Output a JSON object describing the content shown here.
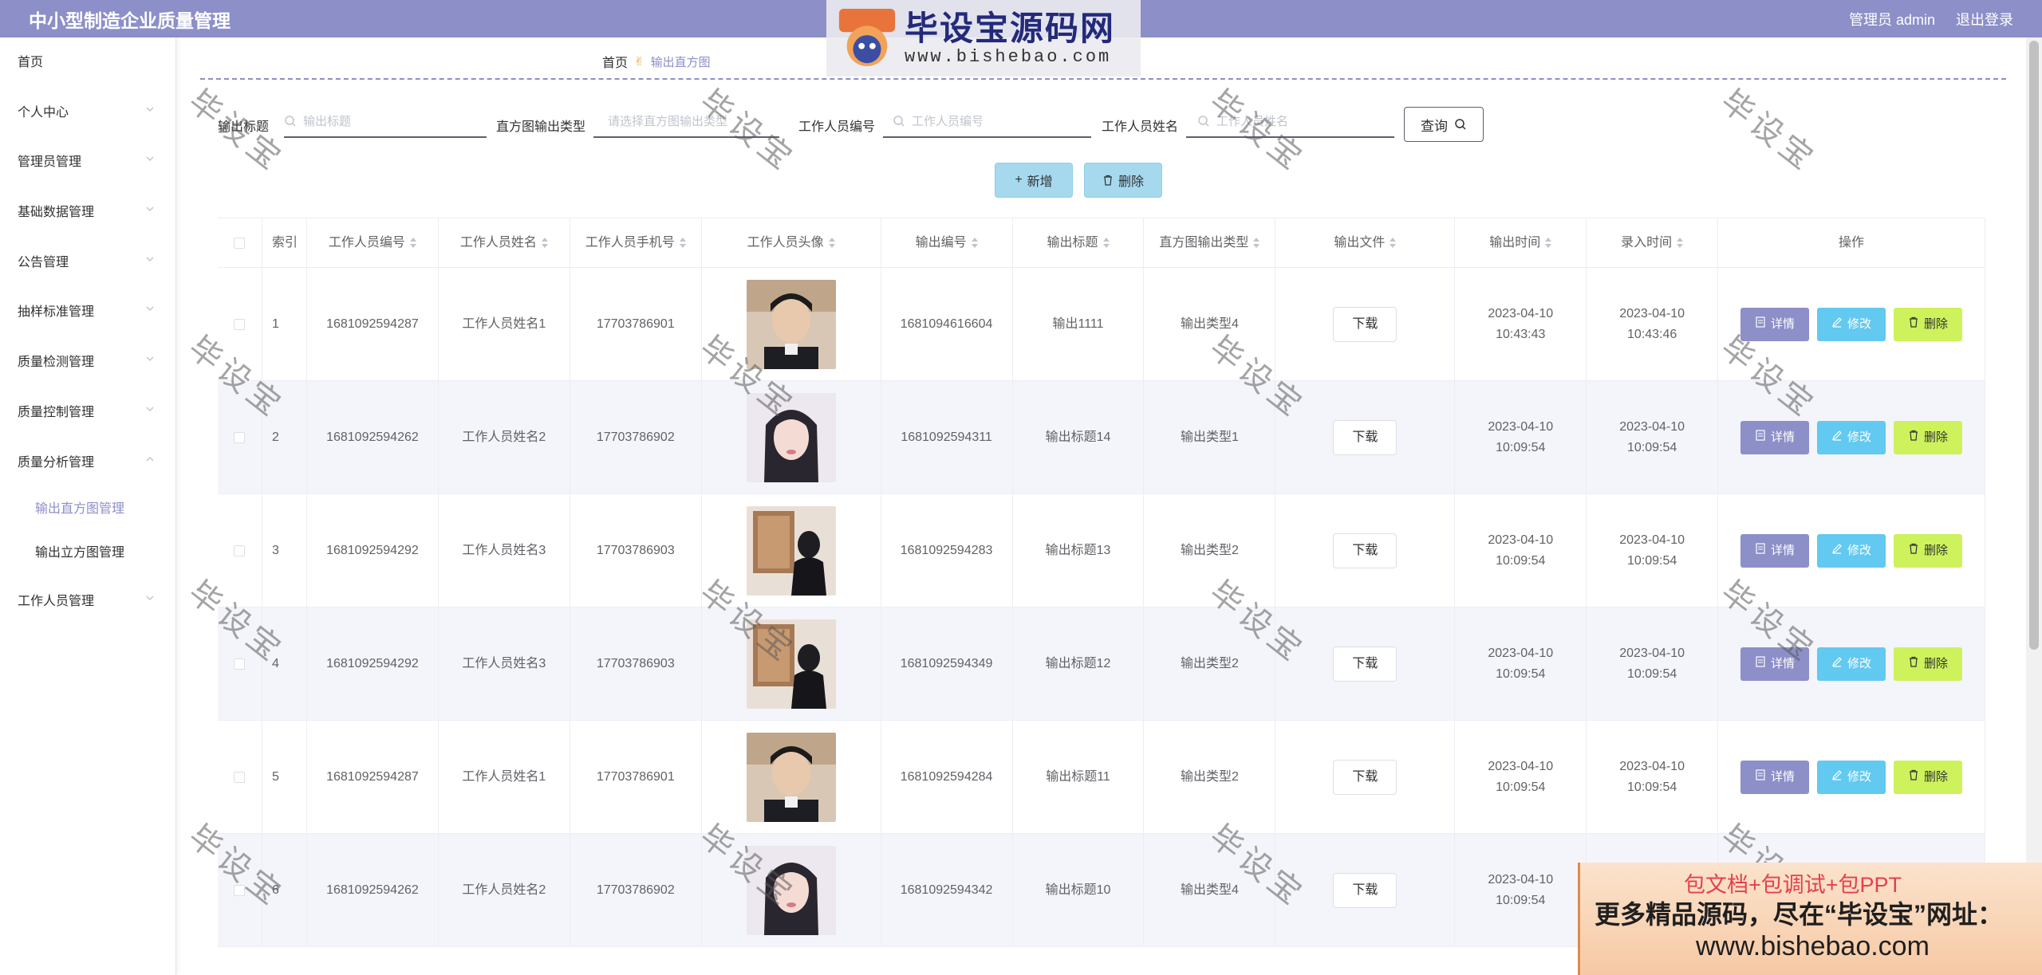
{
  "header": {
    "title": "中小型制造企业质量管理",
    "user": "管理员 admin",
    "logout": "退出登录"
  },
  "sidebar": {
    "items": [
      {
        "label": "首页"
      },
      {
        "label": "个人中心"
      },
      {
        "label": "管理员管理"
      },
      {
        "label": "基础数据管理"
      },
      {
        "label": "公告管理"
      },
      {
        "label": "抽样标准管理"
      },
      {
        "label": "质量检测管理"
      },
      {
        "label": "质量控制管理"
      },
      {
        "label": "质量分析管理"
      },
      {
        "label": "输出直方图管理"
      },
      {
        "label": "输出立方图管理"
      },
      {
        "label": "工作人员管理"
      }
    ]
  },
  "breadcrumb": {
    "home": "首页",
    "current": "输出直方图"
  },
  "search": {
    "title_label": "输出标题",
    "title_placeholder": "输出标题",
    "type_label": "直方图输出类型",
    "type_placeholder": "请选择直方图输出类型",
    "staff_no_label": "工作人员编号",
    "staff_no_placeholder": "工作人员编号",
    "staff_name_label": "工作人员姓名",
    "staff_name_placeholder": "工作人员姓名",
    "query_button": "查询"
  },
  "actions": {
    "add": "新增",
    "delete": "删除"
  },
  "table": {
    "columns": [
      "",
      "索引",
      "工作人员编号",
      "工作人员姓名",
      "工作人员手机号",
      "工作人员头像",
      "输出编号",
      "输出标题",
      "直方图输出类型",
      "输出文件",
      "输出时间",
      "录入时间",
      "操作"
    ],
    "download_label": "下载",
    "op_detail": "详情",
    "op_edit": "修改",
    "op_delete": "删除",
    "rows": [
      {
        "index": "1",
        "staff_no": "1681092594287",
        "staff_name": "工作人员姓名1",
        "phone": "17703786901",
        "avatar": "man-a",
        "out_no": "1681094616604",
        "out_title": "输出1111",
        "out_type": "输出类型4",
        "out_time": "2023-04-10 10:43:43",
        "entry_time": "2023-04-10 10:43:46"
      },
      {
        "index": "2",
        "staff_no": "1681092594262",
        "staff_name": "工作人员姓名2",
        "phone": "17703786902",
        "avatar": "woman",
        "out_no": "1681092594311",
        "out_title": "输出标题14",
        "out_type": "输出类型1",
        "out_time": "2023-04-10 10:09:54",
        "entry_time": "2023-04-10 10:09:54"
      },
      {
        "index": "3",
        "staff_no": "1681092594292",
        "staff_name": "工作人员姓名3",
        "phone": "17703786903",
        "avatar": "man-b",
        "out_no": "1681092594283",
        "out_title": "输出标题13",
        "out_type": "输出类型2",
        "out_time": "2023-04-10 10:09:54",
        "entry_time": "2023-04-10 10:09:54"
      },
      {
        "index": "4",
        "staff_no": "1681092594292",
        "staff_name": "工作人员姓名3",
        "phone": "17703786903",
        "avatar": "man-b",
        "out_no": "1681092594349",
        "out_title": "输出标题12",
        "out_type": "输出类型2",
        "out_time": "2023-04-10 10:09:54",
        "entry_time": "2023-04-10 10:09:54"
      },
      {
        "index": "5",
        "staff_no": "1681092594287",
        "staff_name": "工作人员姓名1",
        "phone": "17703786901",
        "avatar": "man-a",
        "out_no": "1681092594284",
        "out_title": "输出标题11",
        "out_type": "输出类型2",
        "out_time": "2023-04-10 10:09:54",
        "entry_time": "2023-04-10 10:09:54"
      },
      {
        "index": "6",
        "staff_no": "1681092594262",
        "staff_name": "工作人员姓名2",
        "phone": "17703786902",
        "avatar": "woman",
        "out_no": "1681092594342",
        "out_title": "输出标题10",
        "out_type": "输出类型4",
        "out_time": "2023-04-10 10:09:54",
        "entry_time": ""
      }
    ]
  },
  "watermark": "毕设宝",
  "logo": {
    "badge": "毕设宝",
    "name": "毕设宝源码网",
    "url": "www.bishebao.com"
  },
  "promo": {
    "line1": "包文档+包调试+包PPT",
    "line2": "更多精品源码，尽在“毕设宝”网址：",
    "line3": "www.bishebao.com"
  },
  "colors": {
    "primary": "#8c8fc8",
    "edit": "#62c9f0",
    "delete": "#cdf25c",
    "toolbar_button": "#a6d9ee"
  }
}
